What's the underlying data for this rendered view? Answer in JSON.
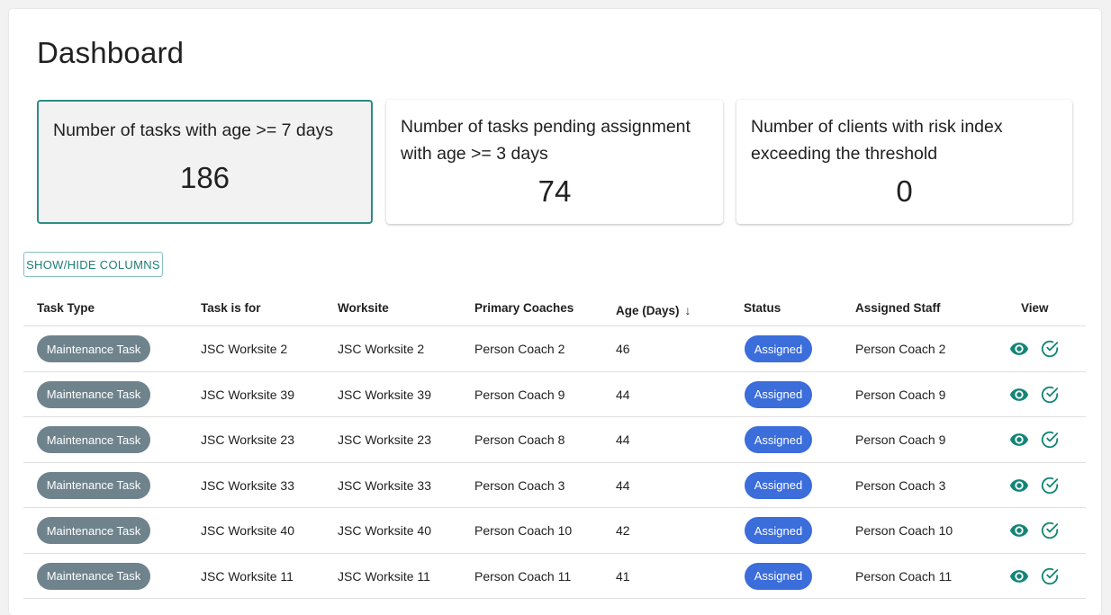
{
  "page": {
    "title": "Dashboard"
  },
  "cards": [
    {
      "label": "Number of tasks with age >= 7 days",
      "value": "186"
    },
    {
      "label": "Number of tasks pending assignment with age >= 3 days",
      "value": "74"
    },
    {
      "label": "Number of clients with risk index exceeding the threshold",
      "value": "0"
    }
  ],
  "toolbar": {
    "show_hide_label": "SHOW/HIDE COLUMNS"
  },
  "table": {
    "columns": {
      "task_type": "Task Type",
      "task_for": "Task is for",
      "worksite": "Worksite",
      "primary_coaches": "Primary Coaches",
      "age": "Age (Days)",
      "age_sort": "↓",
      "status": "Status",
      "assigned_staff": "Assigned Staff",
      "view": "View"
    },
    "rows": [
      {
        "task_type": "Maintenance Task",
        "task_for": "JSC Worksite 2",
        "worksite": "JSC Worksite 2",
        "primary_coaches": "Person Coach 2",
        "age": "46",
        "status": "Assigned",
        "assigned_staff": "Person Coach 2"
      },
      {
        "task_type": "Maintenance Task",
        "task_for": "JSC Worksite 39",
        "worksite": "JSC Worksite 39",
        "primary_coaches": "Person Coach 9",
        "age": "44",
        "status": "Assigned",
        "assigned_staff": "Person Coach 9"
      },
      {
        "task_type": "Maintenance Task",
        "task_for": "JSC Worksite 23",
        "worksite": "JSC Worksite 23",
        "primary_coaches": "Person Coach 8",
        "age": "44",
        "status": "Assigned",
        "assigned_staff": "Person Coach 9"
      },
      {
        "task_type": "Maintenance Task",
        "task_for": "JSC Worksite 33",
        "worksite": "JSC Worksite 33",
        "primary_coaches": "Person Coach 3",
        "age": "44",
        "status": "Assigned",
        "assigned_staff": "Person Coach 3"
      },
      {
        "task_type": "Maintenance Task",
        "task_for": "JSC Worksite 40",
        "worksite": "JSC Worksite 40",
        "primary_coaches": "Person Coach 10",
        "age": "42",
        "status": "Assigned",
        "assigned_staff": "Person Coach 10"
      },
      {
        "task_type": "Maintenance Task",
        "task_for": "JSC Worksite 11",
        "worksite": "JSC Worksite 11",
        "primary_coaches": "Person Coach 11",
        "age": "41",
        "status": "Assigned",
        "assigned_staff": "Person Coach 11"
      }
    ]
  },
  "colors": {
    "accent": "#1f7d77",
    "card_selected_border": "#2e8b84",
    "chip_task_type": "#6f838d",
    "chip_status": "#3b6ddb",
    "icon": "#138577"
  },
  "icons": {
    "view": "eye-icon",
    "complete": "check-circle-icon"
  }
}
